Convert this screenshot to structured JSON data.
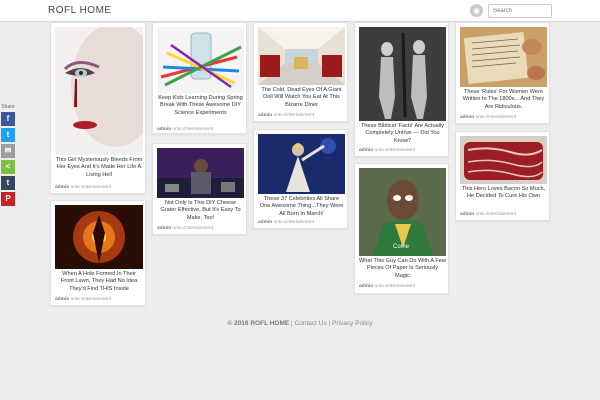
{
  "header": {
    "logo": "ROFL HOME",
    "search_placeholder": "Search"
  },
  "share": {
    "label": "Share"
  },
  "cards": [
    {
      "title": "This Girl Mysteriously Bleeds From Her Eyes And It's Made Her Life A Living Hell",
      "author": "admin",
      "in": "onto",
      "category": "Entertainment"
    },
    {
      "title": "When A Hole Formed In Their Front Lawn, They Had No Idea They'd Find THIS Inside",
      "author": "admin",
      "in": "onto",
      "category": "Entertainment"
    },
    {
      "title": "Keep Kids Learning During Spring Break With These Awesome DIY Science Experiments",
      "author": "admin",
      "in": "onto",
      "category": "Entertainment"
    },
    {
      "title": "Not Only Is This DIY Cheese Grater Effective, But It's Easy To Make, Too!",
      "author": "admin",
      "in": "onto",
      "category": "Entertainment"
    },
    {
      "title": "The Cold, Dead Eyes Of A Giant Doll Will Watch You Eat At This Bizarre Diner",
      "author": "admin",
      "in": "onto",
      "category": "Entertainment"
    },
    {
      "title": "These 37 Celebrities All Share One Awesome Thing...They Were All Born In March!",
      "author": "admin",
      "in": "onto",
      "category": "Entertainment"
    },
    {
      "title": "These Biblical 'Facts' Are Actually Completely Untrue — Did You Know?",
      "author": "admin",
      "in": "onto",
      "category": "Entertainment"
    },
    {
      "title": "What This Guy Can Do With A Few Pieces Of Paper Is Seriously Magic",
      "author": "admin",
      "in": "onto",
      "category": "Entertainment",
      "caption": "Come"
    },
    {
      "title": "These 'Rules' For Women Were Written In The 1800s... And They Are Ridiculous.",
      "author": "admin",
      "in": "onto",
      "category": "Entertainment"
    },
    {
      "title": "This Hero Loves Bacon So Much, He Decided To Cure His Own",
      "author": "admin",
      "in": "onto",
      "category": "Entertainment"
    }
  ],
  "footer": {
    "copyright": "© 2016 ROFL HOME",
    "sep1": "|",
    "contact": "Contact Us",
    "sep2": "|",
    "privacy": "Privacy Policy"
  },
  "colors": {
    "facebook": "#3b5998",
    "twitter": "#1da1f2",
    "email": "#9e9e9e",
    "sharethis": "#7bc043",
    "tumblr": "#35465c",
    "pinterest": "#cb2027"
  },
  "icons": {
    "rss": "rss-icon",
    "facebook": "facebook-icon",
    "twitter": "twitter-icon",
    "email": "email-icon",
    "sharethis": "share-icon",
    "tumblr": "tumblr-icon",
    "pinterest": "pinterest-icon"
  }
}
